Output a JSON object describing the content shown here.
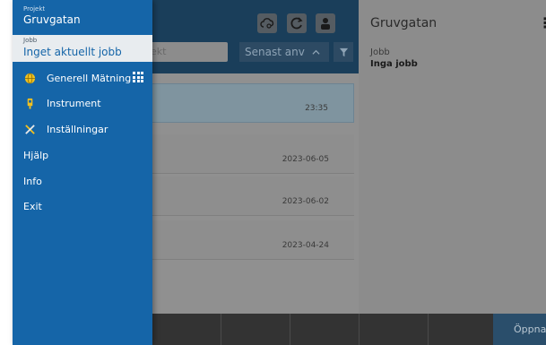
{
  "drawer": {
    "project_label": "Projekt",
    "project_value": "Gruvgatan",
    "job_label": "Jobb",
    "job_value": "Inget aktuellt jobb",
    "menu": [
      {
        "label": "Generell Mätning",
        "icon": "globe-icon"
      },
      {
        "label": "Instrument",
        "icon": "instrument-icon"
      },
      {
        "label": "Inställningar",
        "icon": "tools-icon"
      },
      {
        "label": "Hjälp"
      },
      {
        "label": "Info"
      },
      {
        "label": "Exit"
      }
    ],
    "accent_color": "#1565a8"
  },
  "main": {
    "search_placeholder": "ekt",
    "sort_value": "Senast anv",
    "rows": [
      {
        "date": "23:35",
        "selected": true
      },
      {
        "date": "2023-06-05"
      },
      {
        "date": "2023-06-02"
      },
      {
        "date": "2023-04-24"
      }
    ]
  },
  "right": {
    "title": "Gruvgatan",
    "job_label": "Jobb",
    "job_value": "Inga jobb",
    "open_button": "Öppna"
  }
}
